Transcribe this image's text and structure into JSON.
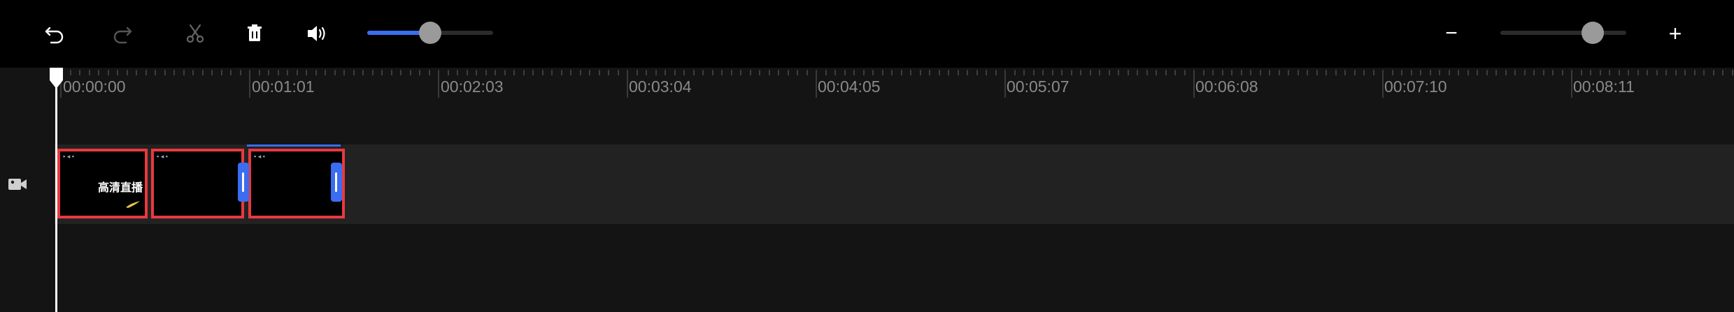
{
  "toolbar": {
    "undo_icon": "undo-icon",
    "redo_icon": "redo-icon",
    "cut_icon": "scissors-icon",
    "delete_icon": "trash-icon",
    "volume_icon": "speaker-icon",
    "volume_level": 0.5,
    "zoom_out_label": "−",
    "zoom_in_label": "+",
    "zoom_level": 0.73,
    "accent_color": "#3a6df0"
  },
  "ruler": {
    "labels": [
      "00:00:00",
      "00:01:01",
      "00:02:03",
      "00:03:04",
      "00:04:05",
      "00:05:07",
      "00:06:08",
      "00:07:10",
      "00:08:11"
    ]
  },
  "track": {
    "type_icon": "video-camera-icon",
    "clips": [
      {
        "caption": "高清直播"
      },
      {
        "caption": ""
      },
      {
        "caption": ""
      }
    ],
    "clip_border_color": "#e8393f"
  },
  "playhead": {
    "icon": "playhead-marker-icon"
  }
}
